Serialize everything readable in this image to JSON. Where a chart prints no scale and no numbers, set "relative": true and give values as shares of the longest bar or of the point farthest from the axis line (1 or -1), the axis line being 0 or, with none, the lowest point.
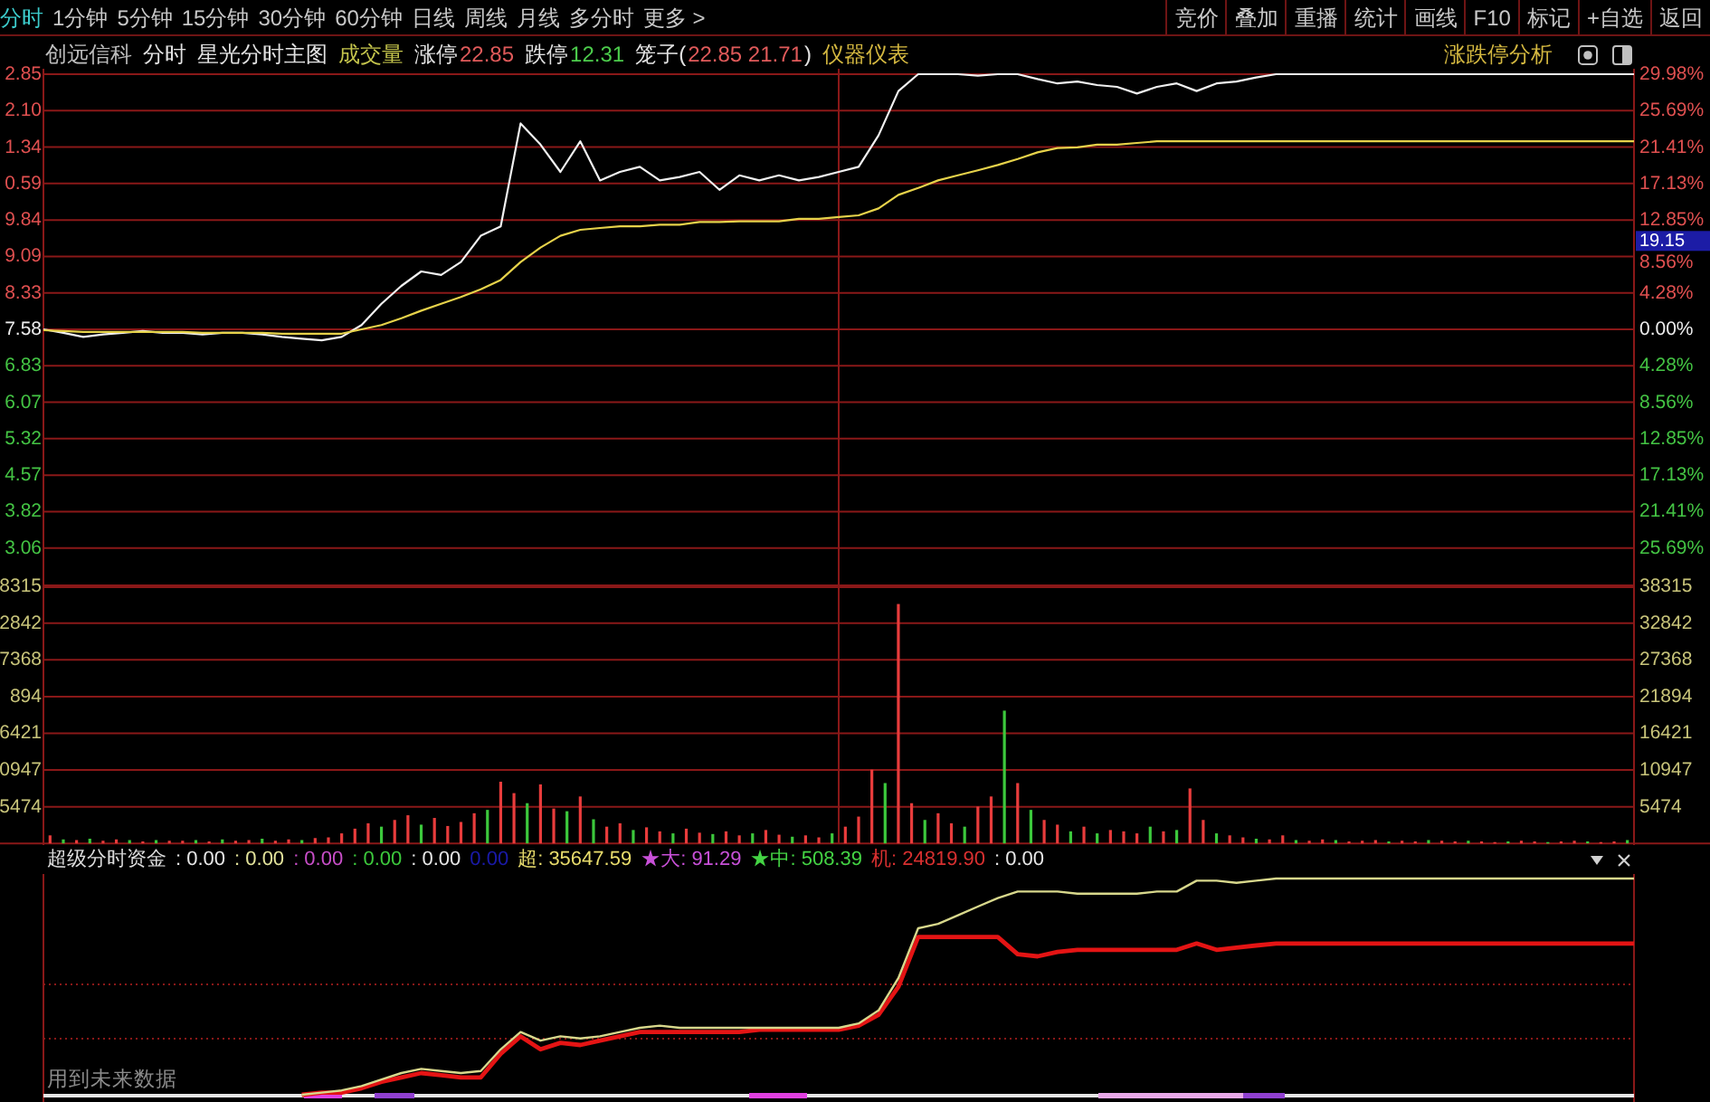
{
  "toolbar": {
    "tabs": [
      {
        "label": "分时",
        "selected": true
      },
      {
        "label": "1分钟",
        "selected": false
      },
      {
        "label": "5分钟",
        "selected": false
      },
      {
        "label": "15分钟",
        "selected": false
      },
      {
        "label": "30分钟",
        "selected": false
      },
      {
        "label": "60分钟",
        "selected": false
      },
      {
        "label": "日线",
        "selected": false
      },
      {
        "label": "周线",
        "selected": false
      },
      {
        "label": "月线",
        "selected": false
      },
      {
        "label": "多分时",
        "selected": false
      },
      {
        "label": "更多 >",
        "selected": false
      }
    ],
    "buttons": [
      "竞价",
      "叠加",
      "重播",
      "统计",
      "画线",
      "F10",
      "标记",
      "+自选",
      "返回"
    ]
  },
  "info_bar": {
    "groups": [
      [
        {
          "text": "创远信科",
          "kind": "stock"
        }
      ],
      [
        {
          "text": "分时",
          "kind": "label"
        }
      ],
      [
        {
          "text": "星光分时主图",
          "kind": "label"
        }
      ],
      [
        {
          "text": "成交量",
          "kind": "indicator"
        }
      ],
      [
        {
          "text": "涨停",
          "kind": "label"
        },
        {
          "text": "22.85",
          "kind": "up"
        }
      ],
      [
        {
          "text": "跌停",
          "kind": "label"
        },
        {
          "text": "12.31",
          "kind": "down"
        }
      ],
      [
        {
          "text": "笼子(",
          "kind": "label"
        },
        {
          "text": "22.85 21.71",
          "kind": "up"
        },
        {
          "text": ")",
          "kind": "label"
        }
      ],
      [
        {
          "text": "仪器仪表",
          "kind": "industry"
        }
      ]
    ],
    "analysis_button": "涨跌停分析"
  },
  "price_chart": {
    "chart_data": {
      "type": "line",
      "grid": true,
      "ylim": [
        -29.98,
        29.98
      ],
      "yticks": [
        {
          "value": 29.98,
          "label": "29.98%"
        },
        {
          "value": 25.69,
          "label": "25.69%"
        },
        {
          "value": 21.41,
          "label": "21.41%"
        },
        {
          "value": 17.13,
          "label": "17.13%"
        },
        {
          "value": 12.85,
          "label": "12.85%"
        },
        {
          "value": 8.56,
          "label": "8.56%"
        },
        {
          "value": 4.28,
          "label": "4.28%"
        },
        {
          "value": 0,
          "label": "0.00%"
        },
        {
          "value": -4.28,
          "label": "4.28%"
        },
        {
          "value": -8.56,
          "label": "8.56%"
        },
        {
          "value": -12.85,
          "label": "12.85%"
        },
        {
          "value": -17.13,
          "label": "17.13%"
        },
        {
          "value": -21.41,
          "label": "21.41%"
        },
        {
          "value": -25.69,
          "label": "25.69%"
        }
      ],
      "series": [
        {
          "color": "#f0f0f0",
          "values": [
            0,
            -0.4,
            -0.9,
            -0.6,
            -0.4,
            -0.2,
            -0.4,
            -0.4,
            -0.6,
            -0.4,
            -0.4,
            -0.6,
            -0.9,
            -1.1,
            -1.3,
            -0.9,
            0.5,
            3,
            5.1,
            6.8,
            6.4,
            7.9,
            11,
            12.1,
            24.2,
            21.7,
            18.5,
            22.1,
            17.5,
            18.5,
            19.1,
            17.5,
            17.9,
            18.5,
            16.4,
            18.1,
            17.5,
            18.1,
            17.5,
            17.9,
            18.5,
            19.1,
            22.8,
            28,
            29.98,
            29.98,
            29.98,
            29.8,
            29.98,
            29.98,
            29.4,
            28.9,
            29.1,
            28.7,
            28.5,
            27.7,
            28.5,
            28.9,
            28,
            28.9,
            29.1,
            29.6,
            29.98,
            29.98,
            29.98,
            29.98,
            29.98,
            29.98,
            29.98,
            29.98,
            29.98,
            29.98,
            29.98,
            29.98,
            29.98,
            29.98,
            29.98,
            29.98,
            29.98,
            29.98,
            29.98
          ]
        },
        {
          "color": "#e6d24a",
          "values": [
            -0.1,
            -0.2,
            -0.3,
            -0.3,
            -0.3,
            -0.3,
            -0.3,
            -0.3,
            -0.4,
            -0.4,
            -0.4,
            -0.4,
            -0.5,
            -0.5,
            -0.5,
            -0.5,
            0,
            0.5,
            1.3,
            2.2,
            3,
            3.8,
            4.7,
            5.8,
            7.9,
            9.6,
            11,
            11.7,
            11.9,
            12.1,
            12.1,
            12.3,
            12.3,
            12.6,
            12.6,
            12.7,
            12.7,
            12.7,
            13,
            13,
            13.2,
            13.4,
            14.2,
            15.8,
            16.6,
            17.5,
            18.1,
            18.7,
            19.3,
            20,
            20.8,
            21.3,
            21.4,
            21.7,
            21.7,
            21.9,
            22.1,
            22.1,
            22.1,
            22.1,
            22.1,
            22.1,
            22.1,
            22.1,
            22.1,
            22.1,
            22.1,
            22.1,
            22.1,
            22.1,
            22.1,
            22.1,
            22.1,
            22.1,
            22.1,
            22.1,
            22.1,
            22.1,
            22.1,
            22.1,
            22.1
          ]
        }
      ]
    },
    "left_axis": [
      "2.85",
      "2.10",
      "1.34",
      "0.59",
      "9.84",
      "9.09",
      "8.33",
      "7.58",
      "6.83",
      "6.07",
      "5.32",
      "4.57",
      "3.82",
      "3.06"
    ],
    "cursor_label": "19.15"
  },
  "volume_chart": {
    "chart_data": {
      "type": "bar",
      "grid": true,
      "ylim": [
        0,
        38315
      ],
      "yticks": [
        38315,
        32842,
        27368,
        21894,
        16421,
        10947,
        5474
      ],
      "series": [
        {
          "color": "#e83c3c",
          "values": [
            1200,
            null,
            500,
            null,
            400,
            600,
            null,
            300,
            null,
            400,
            400,
            null,
            300,
            null,
            400,
            500,
            null,
            400,
            600,
            null,
            800,
            900,
            1500,
            2200,
            3000,
            null,
            3500,
            4200,
            null,
            3800,
            2600,
            3200,
            4500,
            null,
            9200,
            7500,
            null,
            8800,
            5200,
            null,
            7000,
            null,
            2500,
            3000,
            null,
            2400,
            1800,
            null,
            2200,
            1600,
            null,
            1800,
            1200,
            null,
            2000,
            1300,
            null,
            1200,
            900,
            null,
            2500,
            4000,
            11000,
            null,
            35700,
            6000,
            null,
            4500,
            3000,
            null,
            5500,
            7000,
            null,
            9000,
            null,
            3500,
            2800,
            null,
            2500,
            null,
            2000,
            1800,
            1500,
            null,
            1800,
            null,
            8200,
            3500,
            null,
            1200,
            900,
            null,
            600,
            1200,
            null,
            400,
            600,
            null,
            300,
            400,
            500,
            null,
            400,
            300,
            null,
            400,
            300,
            null,
            300,
            200,
            null,
            400,
            300,
            null,
            300,
            400,
            null,
            200,
            300,
            null
          ]
        },
        {
          "color": "#3cc83c",
          "values": [
            null,
            600,
            null,
            700,
            null,
            null,
            500,
            null,
            500,
            null,
            null,
            500,
            null,
            600,
            null,
            null,
            700,
            null,
            null,
            500,
            null,
            null,
            null,
            null,
            null,
            2500,
            null,
            null,
            2800,
            null,
            null,
            null,
            null,
            5000,
            null,
            null,
            6000,
            null,
            null,
            4800,
            null,
            3600,
            null,
            null,
            2000,
            null,
            null,
            1500,
            null,
            null,
            1400,
            null,
            null,
            1500,
            null,
            null,
            1000,
            null,
            null,
            1500,
            null,
            null,
            null,
            9000,
            null,
            null,
            3500,
            null,
            null,
            2500,
            null,
            null,
            19800,
            null,
            5000,
            null,
            null,
            1800,
            null,
            1500,
            null,
            null,
            null,
            2500,
            null,
            2000,
            null,
            null,
            1500,
            null,
            null,
            700,
            null,
            null,
            500,
            null,
            null,
            500,
            null,
            null,
            null,
            300,
            null,
            null,
            500,
            null,
            null,
            400,
            null,
            null,
            300,
            null,
            null,
            200,
            null,
            null,
            300,
            null,
            null,
            500
          ]
        }
      ]
    },
    "left_axis": [
      "8315",
      "2842",
      "7368",
      "894",
      "6421",
      "0947",
      "5474"
    ]
  },
  "indicator": {
    "title": "超级分时资金",
    "values": [
      {
        "text": ": 0.00",
        "color": "#e6e6e6"
      },
      {
        "text": ": 0.00",
        "color": "#e2e29a"
      },
      {
        "text": ": 0.00",
        "color": "#c84ec8"
      },
      {
        "text": ": 0.00",
        "color": "#3cc83c"
      },
      {
        "text": ": 0.00",
        "color": "#e6e6e6"
      },
      {
        "text": "0.00",
        "color": "#1a1aa8"
      },
      {
        "text": "超: 35647.59",
        "color": "#e8dc6c"
      },
      {
        "text": "★大: 91.29",
        "color": "#c850d8"
      },
      {
        "text": "★中: 508.39",
        "color": "#44d444"
      },
      {
        "text": "机: 24819.90",
        "color": "#d83030"
      },
      {
        "text": ": 0.00",
        "color": "#e6e6e6"
      }
    ],
    "chart_data": {
      "type": "line",
      "relative": true,
      "series": [
        {
          "color": "#e41414",
          "values": [
            null,
            null,
            null,
            null,
            null,
            null,
            null,
            null,
            null,
            null,
            null,
            null,
            null,
            0,
            0.01,
            0.01,
            0.03,
            0.06,
            0.08,
            0.1,
            0.09,
            0.08,
            0.08,
            0.19,
            0.27,
            0.21,
            0.24,
            0.23,
            0.25,
            0.27,
            0.29,
            0.29,
            0.29,
            0.29,
            0.29,
            0.29,
            0.3,
            0.3,
            0.3,
            0.3,
            0.3,
            0.32,
            0.37,
            0.5,
            0.73,
            0.73,
            0.73,
            0.73,
            0.73,
            0.65,
            0.64,
            0.66,
            0.67,
            0.67,
            0.67,
            0.67,
            0.67,
            0.67,
            0.7,
            0.67,
            0.68,
            0.69,
            0.7,
            0.7,
            0.7,
            0.7,
            0.7,
            0.7,
            0.7,
            0.7,
            0.7,
            0.7,
            0.7,
            0.7,
            0.7,
            0.7,
            0.7,
            0.7,
            0.7,
            0.7,
            0.7
          ]
        },
        {
          "color": "#d8d88c",
          "values": [
            null,
            null,
            null,
            null,
            null,
            null,
            null,
            null,
            null,
            null,
            null,
            null,
            null,
            0,
            0.01,
            0.02,
            0.04,
            0.07,
            0.1,
            0.12,
            0.11,
            0.1,
            0.11,
            0.21,
            0.29,
            0.25,
            0.27,
            0.26,
            0.27,
            0.29,
            0.31,
            0.32,
            0.31,
            0.31,
            0.31,
            0.31,
            0.31,
            0.31,
            0.31,
            0.31,
            0.31,
            0.33,
            0.39,
            0.54,
            0.77,
            0.79,
            0.83,
            0.87,
            0.91,
            0.94,
            0.94,
            0.94,
            0.93,
            0.93,
            0.93,
            0.93,
            0.94,
            0.94,
            0.99,
            0.99,
            0.98,
            0.99,
            1,
            1,
            1,
            1,
            1,
            1,
            1,
            1,
            1,
            1,
            1,
            1,
            1,
            1,
            1,
            1,
            1,
            1,
            1
          ]
        }
      ]
    },
    "note": "用到未来数据"
  }
}
